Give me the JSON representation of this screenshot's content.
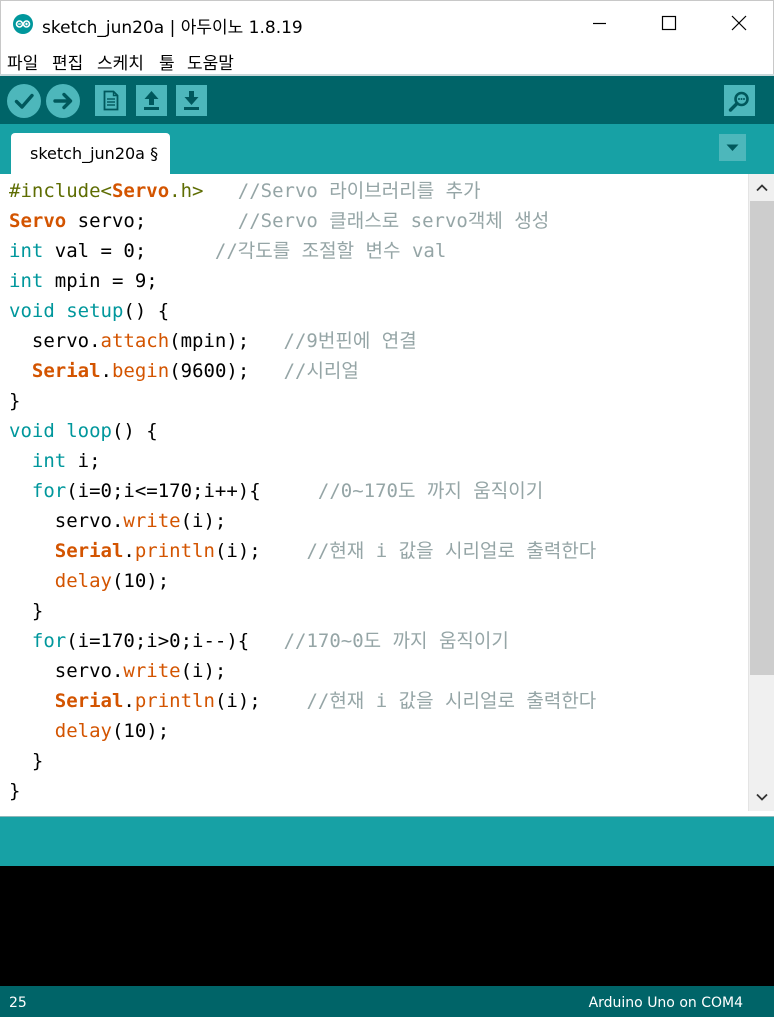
{
  "window": {
    "title": "sketch_jun20a | 아두이노 1.8.19"
  },
  "menu": [
    "파일",
    "편집",
    "스케치",
    "툴",
    "도움말"
  ],
  "toolbar": {
    "buttons": [
      "verify-icon",
      "upload-icon",
      "new-icon",
      "open-icon",
      "save-icon"
    ],
    "serial_monitor": "serial-monitor-icon"
  },
  "tab": {
    "label": "sketch_jun20a §"
  },
  "colors": {
    "toolbar_dark": "#006468",
    "toolbar_light": "#17a1a5",
    "button": "#4db7bb",
    "keyword_teal": "#00979c",
    "function_orange": "#d35400",
    "preprocessor": "#5e6d03",
    "comment": "#95a5a6"
  },
  "code": [
    [
      [
        "pp",
        "#include<"
      ],
      [
        "cls",
        "Servo"
      ],
      [
        "pp",
        ".h>   "
      ],
      [
        "cm",
        "//Servo 라이브러리를 추가"
      ]
    ],
    [
      [
        "cls",
        "Servo"
      ],
      [
        "lit",
        " servo;        "
      ],
      [
        "cm",
        "//Servo 클래스로 servo객체 생성"
      ]
    ],
    [
      [
        "kw",
        "int"
      ],
      [
        "lit",
        " val = 0;      "
      ],
      [
        "cm",
        "//각도를 조절할 변수 val"
      ]
    ],
    [
      [
        "kw",
        "int"
      ],
      [
        "lit",
        " mpin = 9;"
      ]
    ],
    [
      [
        "kw",
        "void"
      ],
      [
        "lit",
        " "
      ],
      [
        "kw",
        "setup"
      ],
      [
        "lit",
        "() {"
      ]
    ],
    [
      [
        "lit",
        "  servo."
      ],
      [
        "fn",
        "attach"
      ],
      [
        "lit",
        "(mpin);   "
      ],
      [
        "cm",
        "//9번핀에 연결"
      ]
    ],
    [
      [
        "lit",
        "  "
      ],
      [
        "cls",
        "Serial"
      ],
      [
        "lit",
        "."
      ],
      [
        "fn",
        "begin"
      ],
      [
        "lit",
        "(9600);   "
      ],
      [
        "cm",
        "//시리얼"
      ]
    ],
    [
      [
        "lit",
        "}"
      ]
    ],
    [
      [
        "kw",
        "void"
      ],
      [
        "lit",
        " "
      ],
      [
        "kw",
        "loop"
      ],
      [
        "lit",
        "() {"
      ]
    ],
    [
      [
        "lit",
        "  "
      ],
      [
        "kw",
        "int"
      ],
      [
        "lit",
        " i;"
      ]
    ],
    [
      [
        "lit",
        "  "
      ],
      [
        "kw",
        "for"
      ],
      [
        "lit",
        "(i=0;i<=170;i++){     "
      ],
      [
        "cm",
        "//0~170도 까지 움직이기"
      ]
    ],
    [
      [
        "lit",
        "    servo."
      ],
      [
        "fn",
        "write"
      ],
      [
        "lit",
        "(i);"
      ]
    ],
    [
      [
        "lit",
        "    "
      ],
      [
        "cls",
        "Serial"
      ],
      [
        "lit",
        "."
      ],
      [
        "fn",
        "println"
      ],
      [
        "lit",
        "(i);    "
      ],
      [
        "cm",
        "//현재 i 값을 시리얼로 출력한다"
      ]
    ],
    [
      [
        "lit",
        "    "
      ],
      [
        "fn",
        "delay"
      ],
      [
        "lit",
        "(10);"
      ]
    ],
    [
      [
        "lit",
        "  }"
      ]
    ],
    [
      [
        "lit",
        "  "
      ],
      [
        "kw",
        "for"
      ],
      [
        "lit",
        "(i=170;i>0;i--){   "
      ],
      [
        "cm",
        "//170~0도 까지 움직이기"
      ]
    ],
    [
      [
        "lit",
        "    servo."
      ],
      [
        "fn",
        "write"
      ],
      [
        "lit",
        "(i);"
      ]
    ],
    [
      [
        "lit",
        "    "
      ],
      [
        "cls",
        "Serial"
      ],
      [
        "lit",
        "."
      ],
      [
        "fn",
        "println"
      ],
      [
        "lit",
        "(i);    "
      ],
      [
        "cm",
        "//현재 i 값을 시리얼로 출력한다"
      ]
    ],
    [
      [
        "lit",
        "    "
      ],
      [
        "fn",
        "delay"
      ],
      [
        "lit",
        "(10);"
      ]
    ],
    [
      [
        "lit",
        "  }"
      ]
    ],
    [
      [
        "lit",
        "}"
      ]
    ]
  ],
  "status": {
    "line": "25",
    "board": "Arduino Uno on COM4"
  }
}
